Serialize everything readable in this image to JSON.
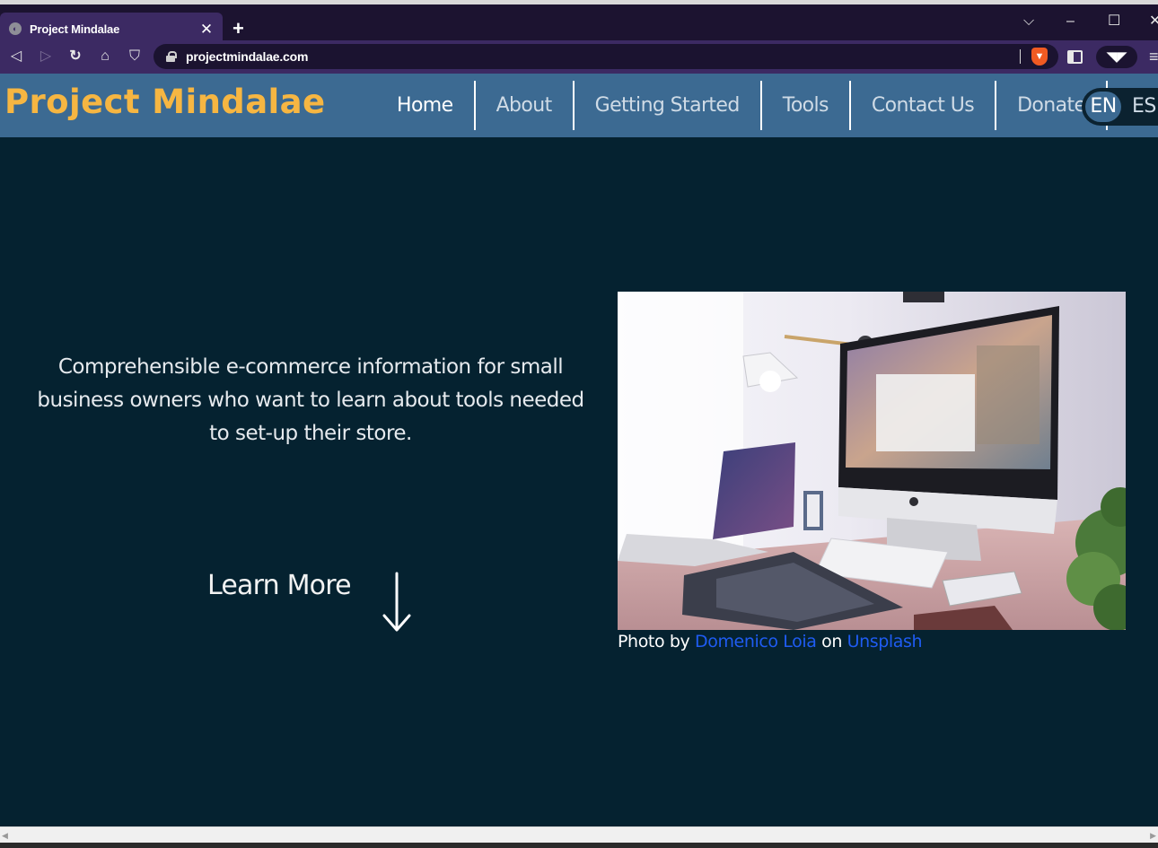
{
  "browser": {
    "tab_title": "Project Mindalae",
    "tab_close": "✕",
    "new_tab": "+",
    "url": "projectmindalae.com",
    "window_controls": {
      "dropdown": "⌵",
      "minimize": "–",
      "maximize": "☐",
      "close": "✕"
    },
    "nav": {
      "back": "◁",
      "forward": "▷",
      "reload": "↻",
      "home": "⌂",
      "bookmark": "⛉"
    },
    "menu": "≡"
  },
  "site": {
    "logo": "Project Mindalae",
    "nav": [
      {
        "label": "Home",
        "active": true
      },
      {
        "label": "About"
      },
      {
        "label": "Getting Started"
      },
      {
        "label": "Tools"
      },
      {
        "label": "Contact Us"
      },
      {
        "label": "Donate"
      }
    ],
    "lang": {
      "en": "EN",
      "es": "ES",
      "selected": "EN"
    }
  },
  "hero": {
    "tagline": "Comprehensible e-commerce information for small business owners who want to learn about tools needed to set-up their store.",
    "learn_more": "Learn More",
    "credit": {
      "prefix": "Photo by",
      "author": "Domenico Loia",
      "middle": "on",
      "source": "Unsplash"
    }
  },
  "colors": {
    "header_bg": "#3c6a92",
    "logo": "#f6b642",
    "main_bg": "#052230",
    "link": "#1f5cf2"
  }
}
